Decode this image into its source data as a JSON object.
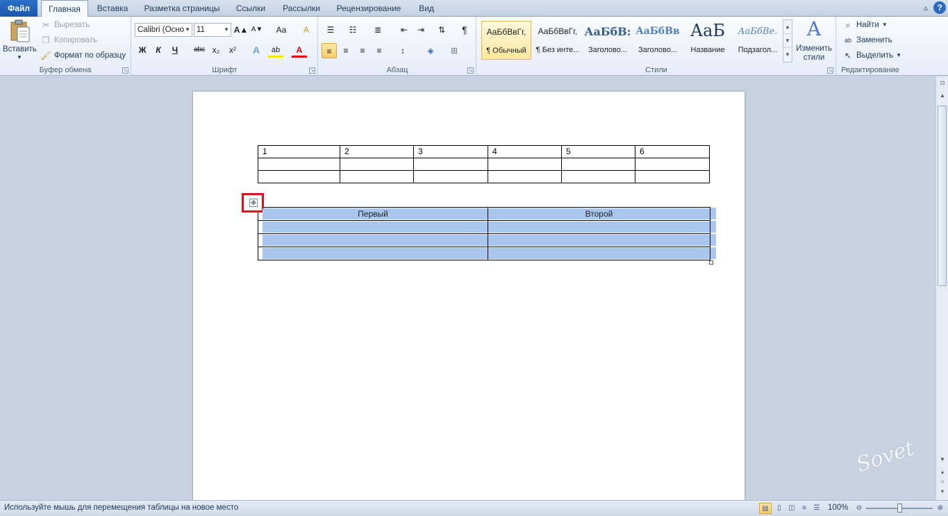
{
  "tabs": [
    "Файл",
    "Главная",
    "Вставка",
    "Разметка страницы",
    "Ссылки",
    "Рассылки",
    "Рецензирование",
    "Вид"
  ],
  "window_buttons": {
    "minimize": "▵",
    "help": "?"
  },
  "clipboard": {
    "paste_label": "Вставить",
    "cut_label": "Вырезать",
    "copy_label": "Копировать",
    "format_painter_label": "Формат по образцу",
    "group_label": "Буфер обмена"
  },
  "font": {
    "font_name": "Calibri (Осно",
    "font_size": "11",
    "group_label": "Шрифт",
    "buttons": {
      "bold": "Ж",
      "italic": "К",
      "underline": "Ч",
      "strike": "abc",
      "subscript": "x₂",
      "superscript": "x²",
      "grow": "A▲",
      "shrink": "A▼",
      "case": "Aa",
      "clear": "A",
      "effects": "A",
      "highlight": "ab",
      "color": "A"
    }
  },
  "paragraph": {
    "group_label": "Абзац",
    "pilcrow": "¶"
  },
  "styles": {
    "group_label": "Стили",
    "items": [
      {
        "sample": "АаБбВвГг,",
        "name": "¶ Обычный"
      },
      {
        "sample": "АаБбВвГг,",
        "name": "¶ Без инте..."
      },
      {
        "sample": "АаБбВ:",
        "name": "Заголово..."
      },
      {
        "sample": "АаБбВв",
        "name": "Заголово..."
      },
      {
        "sample": "АаБ",
        "name": "Название"
      },
      {
        "sample": "АаБбВе.",
        "name": "Подзагол..."
      }
    ],
    "change_styles_label_1": "Изменить",
    "change_styles_label_2": "стили"
  },
  "editing": {
    "find_label": "Найти",
    "replace_label": "Заменить",
    "select_label": "Выделить",
    "group_label": "Редактирование"
  },
  "document": {
    "table1": {
      "rows": [
        [
          "1",
          "2",
          "3",
          "4",
          "5",
          "6"
        ],
        [
          "",
          "",
          "",
          "",
          "",
          ""
        ],
        [
          "",
          "",
          "",
          "",
          "",
          ""
        ]
      ]
    },
    "table2": {
      "header": [
        "Первый",
        "Второй"
      ],
      "rows": [
        [
          "",
          ""
        ],
        [
          "",
          ""
        ],
        [
          "",
          ""
        ]
      ]
    }
  },
  "status": {
    "message": "Используйте мышь для перемещения таблицы на новое место",
    "zoom": "100%"
  },
  "watermark": "Sovet"
}
